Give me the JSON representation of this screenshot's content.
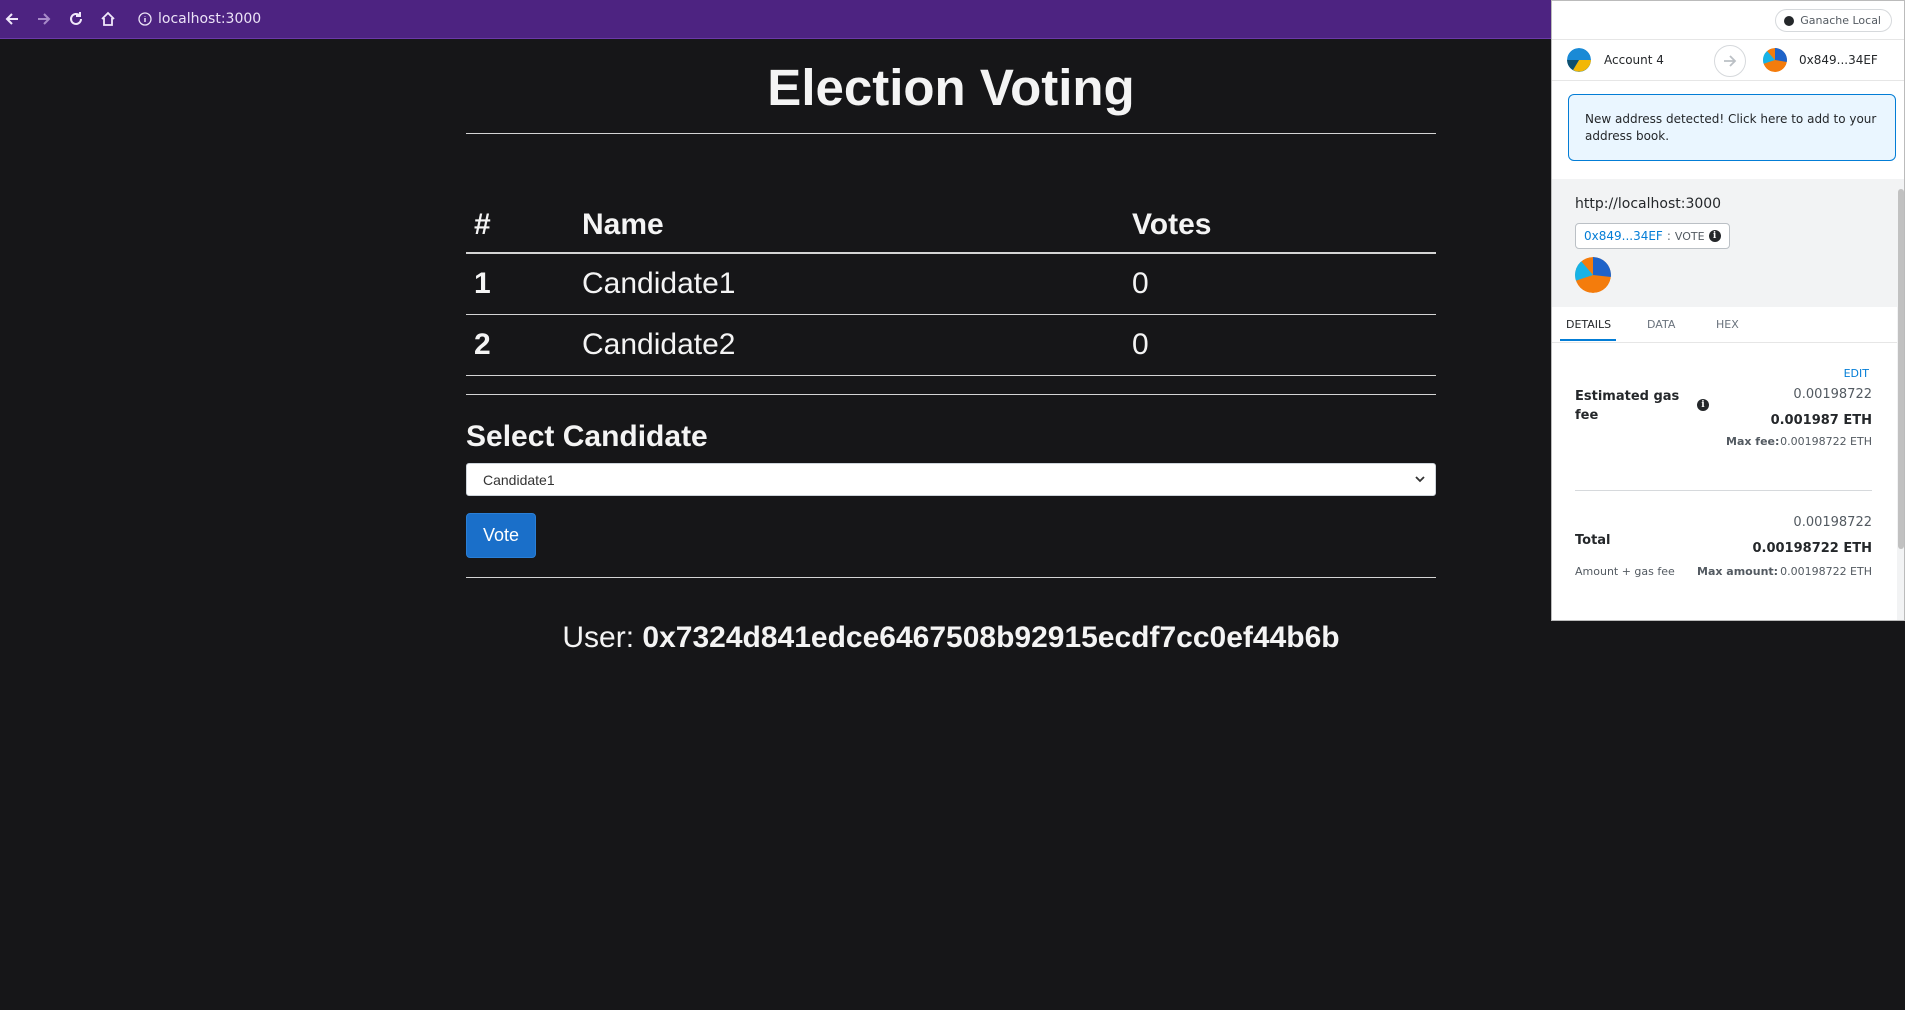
{
  "browser": {
    "url": "localhost:3000"
  },
  "page": {
    "title": "Election Voting",
    "table": {
      "headers": [
        "#",
        "Name",
        "Votes"
      ],
      "rows": [
        {
          "id": "1",
          "name": "Candidate1",
          "votes": "0"
        },
        {
          "id": "2",
          "name": "Candidate2",
          "votes": "0"
        }
      ]
    },
    "select_label": "Select Candidate",
    "select_value": "Candidate1",
    "vote_label": "Vote",
    "user_prefix": "User:",
    "user_address": "0x7324d841edce6467508b92915ecdf7cc0ef44b6b"
  },
  "metamask": {
    "network": "Ganache Local",
    "from_account": "Account 4",
    "to_account": "0x849...34EF",
    "banner": "New address detected! Click here to add to your address book.",
    "origin": "http://localhost:3000",
    "method_address": "0x849...34EF",
    "method_sep": ":",
    "method_name": "VOTE",
    "tabs": [
      "DETAILS",
      "DATA",
      "HEX"
    ],
    "edit_label": "EDIT",
    "gas_label": "Estimated gas fee",
    "gas_value_small": "0.00198722",
    "gas_value_bold": "0.001987 ETH",
    "max_fee_label": "Max fee:",
    "max_fee_value": "0.00198722 ETH",
    "total_label": "Total",
    "total_value_small": "0.00198722",
    "total_value_bold": "0.00198722 ETH",
    "amount_gas_label": "Amount + gas fee",
    "max_amount_label": "Max amount:",
    "max_amount_value": "0.00198722 ETH"
  },
  "colors": {
    "browser_bar": "#4d2381",
    "page_bg": "#161618",
    "vote_button": "#1a6fc9",
    "metamask_blue": "#037dd6"
  },
  "icons": [
    "back-arrow-icon",
    "forward-arrow-icon",
    "reload-icon",
    "home-icon",
    "info-icon",
    "chevron-down-icon",
    "right-arrow-icon",
    "network-dot-icon"
  ]
}
